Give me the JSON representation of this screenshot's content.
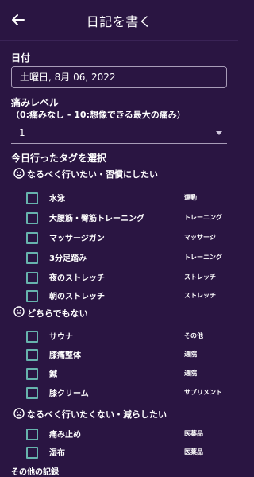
{
  "header": {
    "title": "日記を書く",
    "back_icon": "arrow-left-icon"
  },
  "date": {
    "label": "日付",
    "value": "土曜日, 8月 06, 2022"
  },
  "pain": {
    "label": "痛みレベル",
    "hint": "（0:痛みなし - 10:想像できる最大の痛み）",
    "value": "1"
  },
  "tags": {
    "label": "今日行ったタグを選択",
    "groups": [
      {
        "label": "なるべく行いたい・習慣にしたい",
        "icon": "smile-icon",
        "items": [
          {
            "name": "水泳",
            "category": "運動",
            "checked": false
          },
          {
            "name": "大腰筋・臀筋トレーニング",
            "category": "トレーニング",
            "checked": false
          },
          {
            "name": "マッサージガン",
            "category": "マッサージ",
            "checked": false
          },
          {
            "name": "3分足踏み",
            "category": "トレーニング",
            "checked": false
          },
          {
            "name": "夜のストレッチ",
            "category": "ストレッチ",
            "checked": false
          },
          {
            "name": "朝のストレッチ",
            "category": "ストレッチ",
            "checked": false
          }
        ]
      },
      {
        "label": "どちらでもない",
        "icon": "neutral-face-icon",
        "items": [
          {
            "name": "サウナ",
            "category": "その他",
            "checked": false
          },
          {
            "name": "膝痛整体",
            "category": "通院",
            "checked": false
          },
          {
            "name": "鍼",
            "category": "通院",
            "checked": false
          },
          {
            "name": "膝クリーム",
            "category": "サプリメント",
            "checked": false
          }
        ]
      },
      {
        "label": "なるべく行いたくない・減らしたい",
        "icon": "frown-icon",
        "items": [
          {
            "name": "痛み止め",
            "category": "医薬品",
            "checked": false
          },
          {
            "name": "湿布",
            "category": "医薬品",
            "checked": false
          }
        ]
      }
    ]
  },
  "other": {
    "label": "その他の記録"
  },
  "colors": {
    "background": "#2a1542",
    "checkbox": "#67b3ad",
    "border": "#a89cb8"
  }
}
